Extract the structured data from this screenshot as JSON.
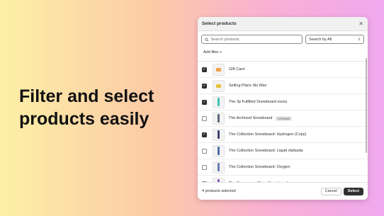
{
  "headline": {
    "line1": "Filter and select",
    "line2": "products easily"
  },
  "modal": {
    "title": "Select products",
    "close_glyph": "✕",
    "search": {
      "placeholder": "Search products"
    },
    "search_by": {
      "label": "Search by",
      "value": "All",
      "icon": "chevron-up-down-icon"
    },
    "add_filter": "Add filter +",
    "products": [
      {
        "name": "Gift Card",
        "checked": true,
        "badge": "",
        "thumb_color": "#f0a14a"
      },
      {
        "name": "Selling Plans Ski Wax",
        "checked": true,
        "badge": "",
        "thumb_color": "#e6c23a"
      },
      {
        "name": "The 3p Fulfilled Snowboard sssss",
        "checked": true,
        "badge": "",
        "thumb_color": "#3fc4b0"
      },
      {
        "name": "The Archived Snowboard",
        "checked": false,
        "badge": "Archived",
        "thumb_color": "#5a6a7a"
      },
      {
        "name": "The Collection Snowboard: Hydrogen (Copy)",
        "checked": true,
        "badge": "",
        "thumb_color": "#3b3f6e"
      },
      {
        "name": "The Collection Snowboard: Liquid sfafasda",
        "checked": false,
        "badge": "",
        "thumb_color": "#4a6fa5"
      },
      {
        "name": "The Collection Snowboard: Oxygen",
        "checked": false,
        "badge": "",
        "thumb_color": "#6b7bb5"
      },
      {
        "name": "The Compare at Price Snowboard",
        "checked": false,
        "badge": "",
        "thumb_color": "#8a5ac0"
      }
    ],
    "footer": {
      "selected_text": "4 products selected",
      "cancel": "Cancel",
      "select": "Select"
    }
  }
}
